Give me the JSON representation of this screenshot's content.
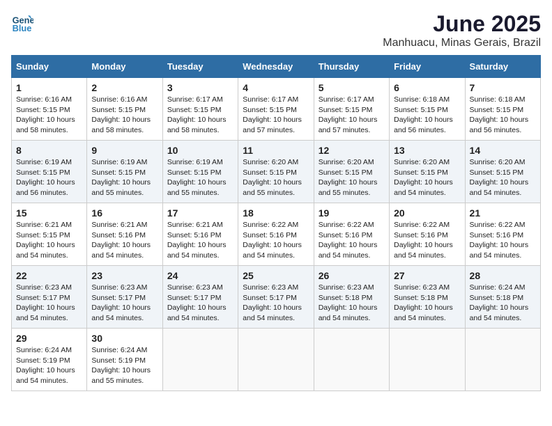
{
  "header": {
    "logo_line1": "General",
    "logo_line2": "Blue",
    "month": "June 2025",
    "location": "Manhuacu, Minas Gerais, Brazil"
  },
  "weekdays": [
    "Sunday",
    "Monday",
    "Tuesday",
    "Wednesday",
    "Thursday",
    "Friday",
    "Saturday"
  ],
  "weeks": [
    [
      {
        "day": "1",
        "info": "Sunrise: 6:16 AM\nSunset: 5:15 PM\nDaylight: 10 hours\nand 58 minutes."
      },
      {
        "day": "2",
        "info": "Sunrise: 6:16 AM\nSunset: 5:15 PM\nDaylight: 10 hours\nand 58 minutes."
      },
      {
        "day": "3",
        "info": "Sunrise: 6:17 AM\nSunset: 5:15 PM\nDaylight: 10 hours\nand 58 minutes."
      },
      {
        "day": "4",
        "info": "Sunrise: 6:17 AM\nSunset: 5:15 PM\nDaylight: 10 hours\nand 57 minutes."
      },
      {
        "day": "5",
        "info": "Sunrise: 6:17 AM\nSunset: 5:15 PM\nDaylight: 10 hours\nand 57 minutes."
      },
      {
        "day": "6",
        "info": "Sunrise: 6:18 AM\nSunset: 5:15 PM\nDaylight: 10 hours\nand 56 minutes."
      },
      {
        "day": "7",
        "info": "Sunrise: 6:18 AM\nSunset: 5:15 PM\nDaylight: 10 hours\nand 56 minutes."
      }
    ],
    [
      {
        "day": "8",
        "info": "Sunrise: 6:19 AM\nSunset: 5:15 PM\nDaylight: 10 hours\nand 56 minutes."
      },
      {
        "day": "9",
        "info": "Sunrise: 6:19 AM\nSunset: 5:15 PM\nDaylight: 10 hours\nand 55 minutes."
      },
      {
        "day": "10",
        "info": "Sunrise: 6:19 AM\nSunset: 5:15 PM\nDaylight: 10 hours\nand 55 minutes."
      },
      {
        "day": "11",
        "info": "Sunrise: 6:20 AM\nSunset: 5:15 PM\nDaylight: 10 hours\nand 55 minutes."
      },
      {
        "day": "12",
        "info": "Sunrise: 6:20 AM\nSunset: 5:15 PM\nDaylight: 10 hours\nand 55 minutes."
      },
      {
        "day": "13",
        "info": "Sunrise: 6:20 AM\nSunset: 5:15 PM\nDaylight: 10 hours\nand 54 minutes."
      },
      {
        "day": "14",
        "info": "Sunrise: 6:20 AM\nSunset: 5:15 PM\nDaylight: 10 hours\nand 54 minutes."
      }
    ],
    [
      {
        "day": "15",
        "info": "Sunrise: 6:21 AM\nSunset: 5:15 PM\nDaylight: 10 hours\nand 54 minutes."
      },
      {
        "day": "16",
        "info": "Sunrise: 6:21 AM\nSunset: 5:16 PM\nDaylight: 10 hours\nand 54 minutes."
      },
      {
        "day": "17",
        "info": "Sunrise: 6:21 AM\nSunset: 5:16 PM\nDaylight: 10 hours\nand 54 minutes."
      },
      {
        "day": "18",
        "info": "Sunrise: 6:22 AM\nSunset: 5:16 PM\nDaylight: 10 hours\nand 54 minutes."
      },
      {
        "day": "19",
        "info": "Sunrise: 6:22 AM\nSunset: 5:16 PM\nDaylight: 10 hours\nand 54 minutes."
      },
      {
        "day": "20",
        "info": "Sunrise: 6:22 AM\nSunset: 5:16 PM\nDaylight: 10 hours\nand 54 minutes."
      },
      {
        "day": "21",
        "info": "Sunrise: 6:22 AM\nSunset: 5:16 PM\nDaylight: 10 hours\nand 54 minutes."
      }
    ],
    [
      {
        "day": "22",
        "info": "Sunrise: 6:23 AM\nSunset: 5:17 PM\nDaylight: 10 hours\nand 54 minutes."
      },
      {
        "day": "23",
        "info": "Sunrise: 6:23 AM\nSunset: 5:17 PM\nDaylight: 10 hours\nand 54 minutes."
      },
      {
        "day": "24",
        "info": "Sunrise: 6:23 AM\nSunset: 5:17 PM\nDaylight: 10 hours\nand 54 minutes."
      },
      {
        "day": "25",
        "info": "Sunrise: 6:23 AM\nSunset: 5:17 PM\nDaylight: 10 hours\nand 54 minutes."
      },
      {
        "day": "26",
        "info": "Sunrise: 6:23 AM\nSunset: 5:18 PM\nDaylight: 10 hours\nand 54 minutes."
      },
      {
        "day": "27",
        "info": "Sunrise: 6:23 AM\nSunset: 5:18 PM\nDaylight: 10 hours\nand 54 minutes."
      },
      {
        "day": "28",
        "info": "Sunrise: 6:24 AM\nSunset: 5:18 PM\nDaylight: 10 hours\nand 54 minutes."
      }
    ],
    [
      {
        "day": "29",
        "info": "Sunrise: 6:24 AM\nSunset: 5:19 PM\nDaylight: 10 hours\nand 54 minutes."
      },
      {
        "day": "30",
        "info": "Sunrise: 6:24 AM\nSunset: 5:19 PM\nDaylight: 10 hours\nand 55 minutes."
      },
      {
        "day": "",
        "info": ""
      },
      {
        "day": "",
        "info": ""
      },
      {
        "day": "",
        "info": ""
      },
      {
        "day": "",
        "info": ""
      },
      {
        "day": "",
        "info": ""
      }
    ]
  ]
}
